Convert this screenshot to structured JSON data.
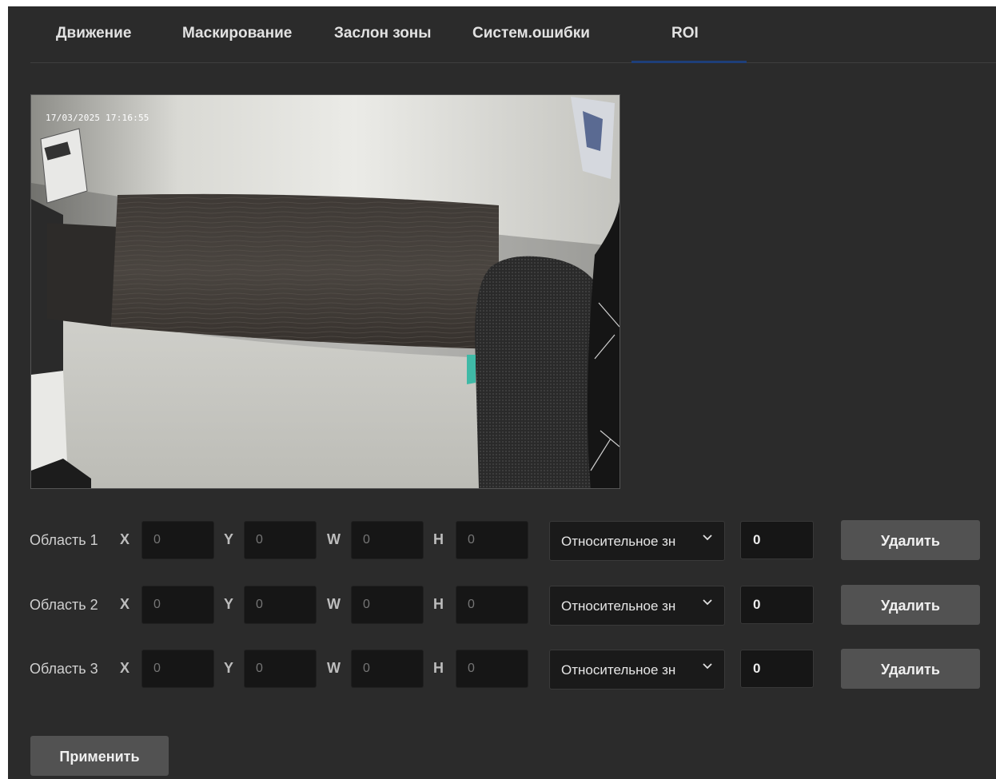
{
  "tabs": [
    {
      "label": "Движение"
    },
    {
      "label": "Маскирование"
    },
    {
      "label": "Заслон зоны"
    },
    {
      "label": "Систем.ошибки"
    },
    {
      "label": "ROI",
      "active": true
    }
  ],
  "video": {
    "timestamp": "17/03/2025 17:16:55"
  },
  "axis_labels": {
    "x": "X",
    "y": "Y",
    "w": "W",
    "h": "H"
  },
  "regions": [
    {
      "label": "Область 1",
      "x_placeholder": "0",
      "y_placeholder": "0",
      "w_placeholder": "0",
      "h_placeholder": "0",
      "mode": "Относительное зн",
      "value": "0",
      "delete_label": "Удалить"
    },
    {
      "label": "Область 2",
      "x_placeholder": "0",
      "y_placeholder": "0",
      "w_placeholder": "0",
      "h_placeholder": "0",
      "mode": "Относительное зн",
      "value": "0",
      "delete_label": "Удалить"
    },
    {
      "label": "Область 3",
      "x_placeholder": "0",
      "y_placeholder": "0",
      "w_placeholder": "0",
      "h_placeholder": "0",
      "mode": "Относительное зн",
      "value": "0",
      "delete_label": "Удалить"
    }
  ],
  "apply_label": "Применить",
  "colors": {
    "panel_bg": "#2b2b2b",
    "active_tab_indicator": "#1e3f7a",
    "button_bg": "#525252"
  },
  "icons": {
    "dropdown": "chevron-down-icon"
  }
}
